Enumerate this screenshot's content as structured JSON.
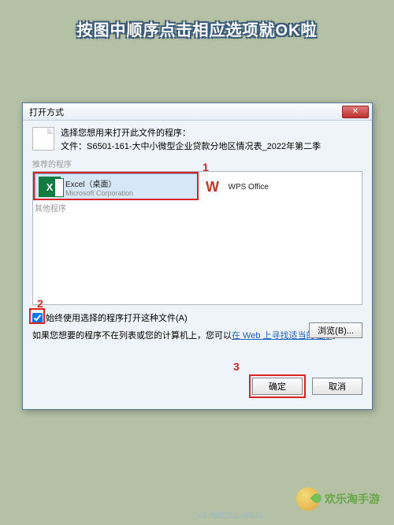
{
  "banner": "按图中顺序点击相应选项就OK啦",
  "dialog": {
    "title": "打开方式",
    "close": "✕",
    "prompt_line1": "选择您想用来打开此文件的程序：",
    "prompt_line2": "文件：S6501-161-大中小微型企业贷款分地区情况表_2022年第二季",
    "section_recommended": "推荐的程序",
    "section_other": "其他程序",
    "programs": [
      {
        "name": "Excel（桌面）",
        "publisher": "Microsoft Corporation",
        "icon_letter": "X"
      },
      {
        "name": "WPS Office",
        "publisher": "",
        "icon_letter": "W"
      }
    ],
    "checkbox_label": "始终使用选择的程序打开这种文件(A)",
    "hint_prefix": "如果您想要的程序不在列表或您的计算机上，您可以",
    "hint_link": "在 Web 上寻找适当的程序",
    "hint_suffix": "。",
    "browse_btn": "浏览(B)...",
    "ok_btn": "确定",
    "cancel_btn": "取消"
  },
  "annotations": {
    "step1": "1",
    "step2": "2",
    "step3": "3"
  },
  "footer": {
    "brand": "欢乐淘手游",
    "watermark": "XX 到此为止a8841"
  }
}
